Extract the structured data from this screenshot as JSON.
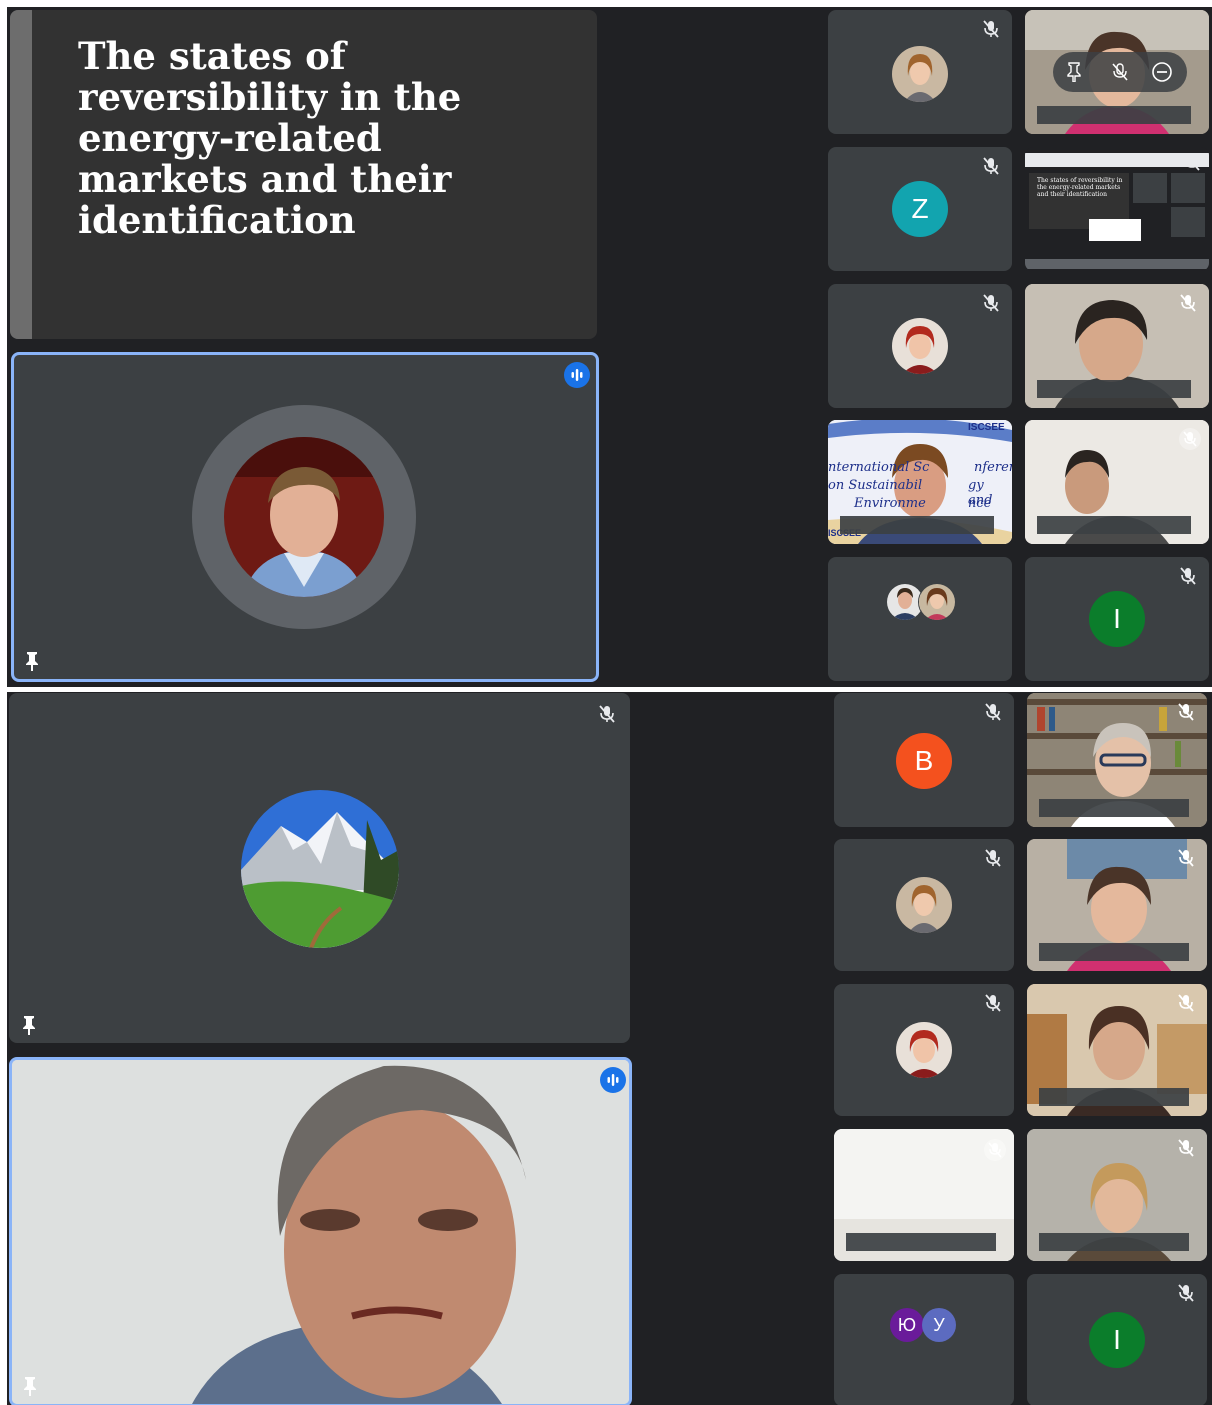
{
  "session1": {
    "slide": {
      "title": "The states of reversibility in the energy-related markets and their identification"
    },
    "thumbnail_slide": {
      "title": "The states of reversibility in the energy-related markets and their identification"
    },
    "tiles": [
      {
        "type": "photo-avatar",
        "muted": true
      },
      {
        "type": "camera",
        "muted": true,
        "hover_controls": [
          "pin-icon",
          "mic-off-icon",
          "remove-icon"
        ]
      },
      {
        "type": "letter-avatar",
        "letter": "Z",
        "color": "#12a4af",
        "muted": true
      },
      {
        "type": "screen-share",
        "muted": true
      },
      {
        "type": "photo-avatar",
        "muted": true
      },
      {
        "type": "camera",
        "muted": true
      },
      {
        "type": "camera",
        "muted": false,
        "banner_text": [
          "nternational Sc",
          "nferen",
          "on Sustainabil",
          "gy and",
          "Environme",
          "nce"
        ],
        "banner_logo": "ISCSEE",
        "banner_corner": "ISCSEE"
      },
      {
        "type": "camera",
        "muted": true
      },
      {
        "type": "group-avatars",
        "count": 2
      },
      {
        "type": "letter-avatar",
        "letter": "I",
        "color": "#0b7d2b",
        "muted": true
      }
    ]
  },
  "session2": {
    "tiles": [
      {
        "type": "letter-avatar",
        "letter": "B",
        "color": "#f4511e",
        "muted": true
      },
      {
        "type": "camera",
        "muted": true
      },
      {
        "type": "photo-avatar",
        "muted": true
      },
      {
        "type": "camera",
        "muted": true
      },
      {
        "type": "photo-avatar",
        "muted": true
      },
      {
        "type": "camera",
        "muted": true
      },
      {
        "type": "camera",
        "muted": true
      },
      {
        "type": "camera",
        "muted": true
      },
      {
        "type": "letter-pair",
        "letters": [
          "Ю",
          "У"
        ],
        "colors": [
          "#6a1b9a",
          "#5c6bc0"
        ]
      },
      {
        "type": "letter-avatar",
        "letter": "I",
        "color": "#0b7d2b",
        "muted": true
      }
    ]
  },
  "colors": {
    "meet_background": "#202124",
    "tile_background": "#3c4043",
    "active_speaker_border": "#8ab4f8",
    "speaking_indicator": "#1a73e8"
  }
}
